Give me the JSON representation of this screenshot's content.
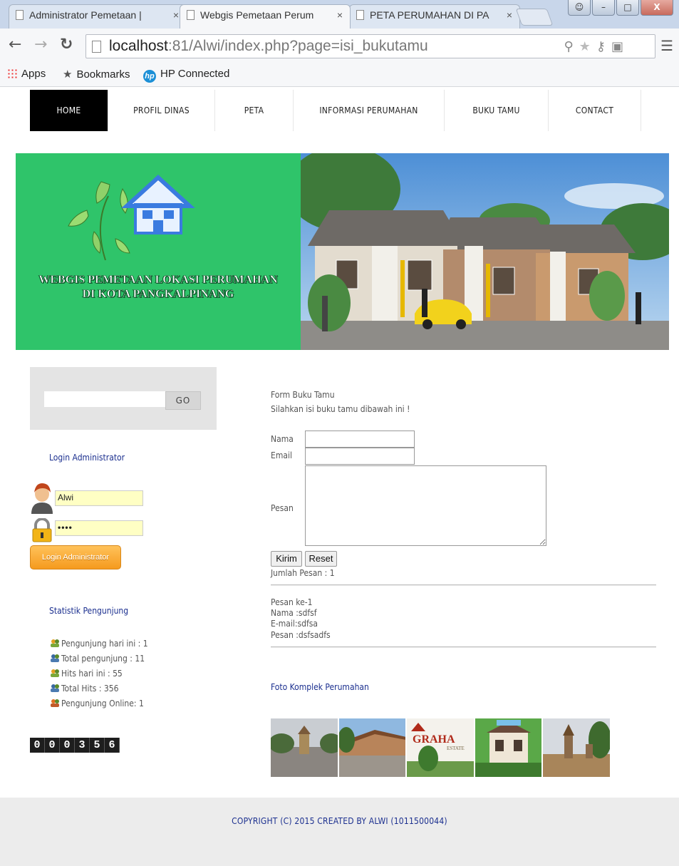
{
  "browser": {
    "tabs": [
      {
        "label": "Administrator Pemetaan |",
        "close": "×"
      },
      {
        "label": "Webgis Pemetaan Perum",
        "close": "×"
      },
      {
        "label": "PETA PERUMAHAN DI PA",
        "close": "×"
      }
    ],
    "url_host": "localhost",
    "url_rest": ":81/Alwi/index.php?page=isi_bukutamu",
    "bookmarks": [
      "Apps",
      "Bookmarks",
      "HP Connected"
    ],
    "hp_logo": "hp",
    "window_buttons": {
      "min": "–",
      "max": "□",
      "close": "X"
    }
  },
  "nav": [
    "HOME",
    "PROFIL DINAS",
    "PETA",
    "INFORMASI PERUMAHAN",
    "BUKU TAMU",
    "CONTACT"
  ],
  "banner": {
    "line1": "WEBGIS PEMETAAN LOKASI PERUMAHAN",
    "line2": "DI KOTA PANGKALPINANG"
  },
  "sidebar": {
    "search_button": "GO",
    "login_heading": "Login Administrator",
    "username": "Alwi",
    "password": "••••",
    "login_button": "Login Administrator",
    "stats_heading": "Statistik Pengunjung",
    "stats": [
      "Pengunjung hari ini : 1",
      "Total pengunjung : 11",
      "Hits hari ini : 55",
      "Total Hits : 356",
      "Pengunjung Online: 1"
    ],
    "counter": [
      "0",
      "0",
      "0",
      "3",
      "5",
      "6"
    ]
  },
  "form": {
    "title": "Form Buku Tamu",
    "subtitle": "Silahkan isi buku tamu dibawah ini !",
    "name_label": "Nama",
    "email_label": "Email",
    "message_label": "Pesan",
    "submit": "Kirim",
    "reset": "Reset",
    "count": "Jumlah Pesan : 1"
  },
  "entries": [
    {
      "index": "Pesan ke-1",
      "name": "Nama :sdfsf",
      "email": "E-mail:sdfsa",
      "message": "Pesan :dsfsadfs"
    }
  ],
  "photos": {
    "heading": "Foto Komplek Perumahan",
    "graha_text": "GRAHA",
    "graha_sub": "ESTATE"
  },
  "footer": "COPYRIGHT (C) 2015 CREATED BY ALWI (1011500044)",
  "colors": {
    "banner_green": "#2fc46a",
    "link_blue": "#1b2f8f",
    "nav_active": "#000000",
    "login_orange": "#f59a1e"
  }
}
